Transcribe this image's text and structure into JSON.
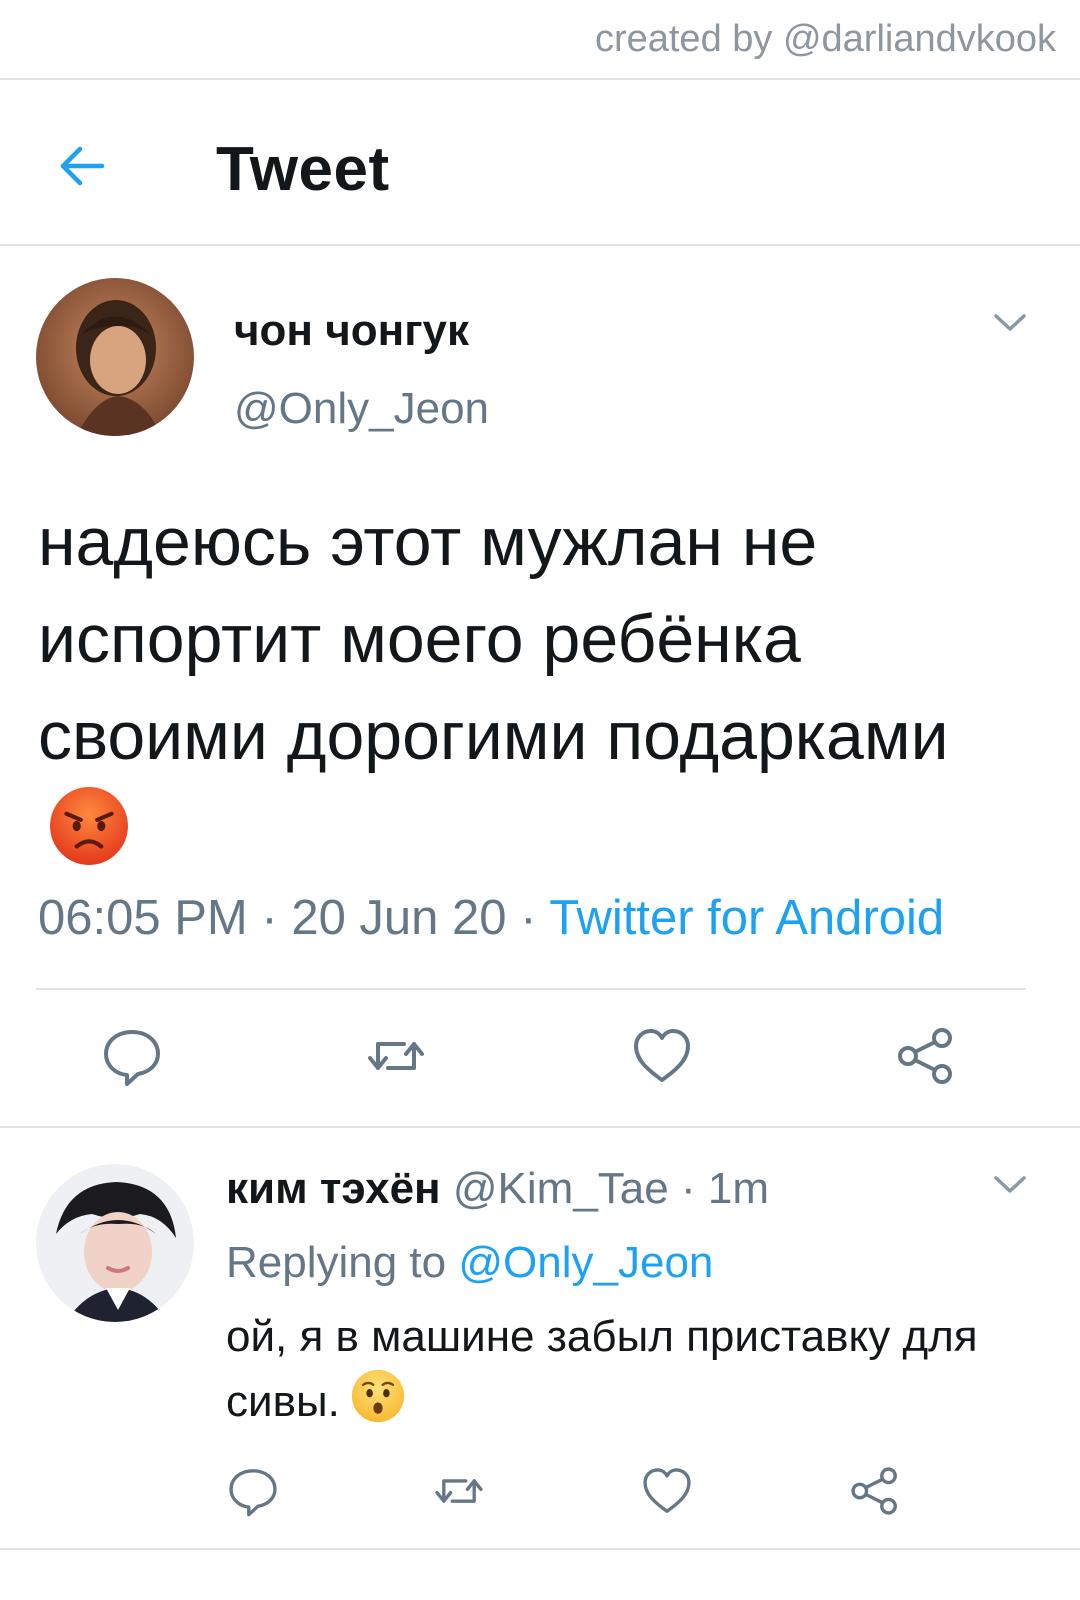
{
  "credit": "created by @darliandvkook",
  "header": {
    "title": "Tweet",
    "back_icon": "arrow-left-icon"
  },
  "tweet": {
    "display_name": "чон чонгук",
    "handle": "@Only_Jeon",
    "text": "надеюсь этот мужлан не испортит моего ребёнка своими дорогими подарками",
    "emoji": "pouting-face-emoji",
    "time": "06:05 PM",
    "dot": "·",
    "date": "20 Jun 20",
    "source": "Twitter for Android"
  },
  "reply": {
    "display_name": "ким тэхён",
    "handle": "@Kim_Tae",
    "dot": "·",
    "age": "1m",
    "replying_label": "Replying to",
    "replying_to": "@Only_Jeon",
    "text": "ой, я в машине забыл приставку для сивы.",
    "emoji": "hushed-face-emoji"
  },
  "colors": {
    "accent": "#1da1f2",
    "secondary_text": "#657786",
    "primary_text": "#14171a",
    "divider": "#dfe3e8"
  }
}
